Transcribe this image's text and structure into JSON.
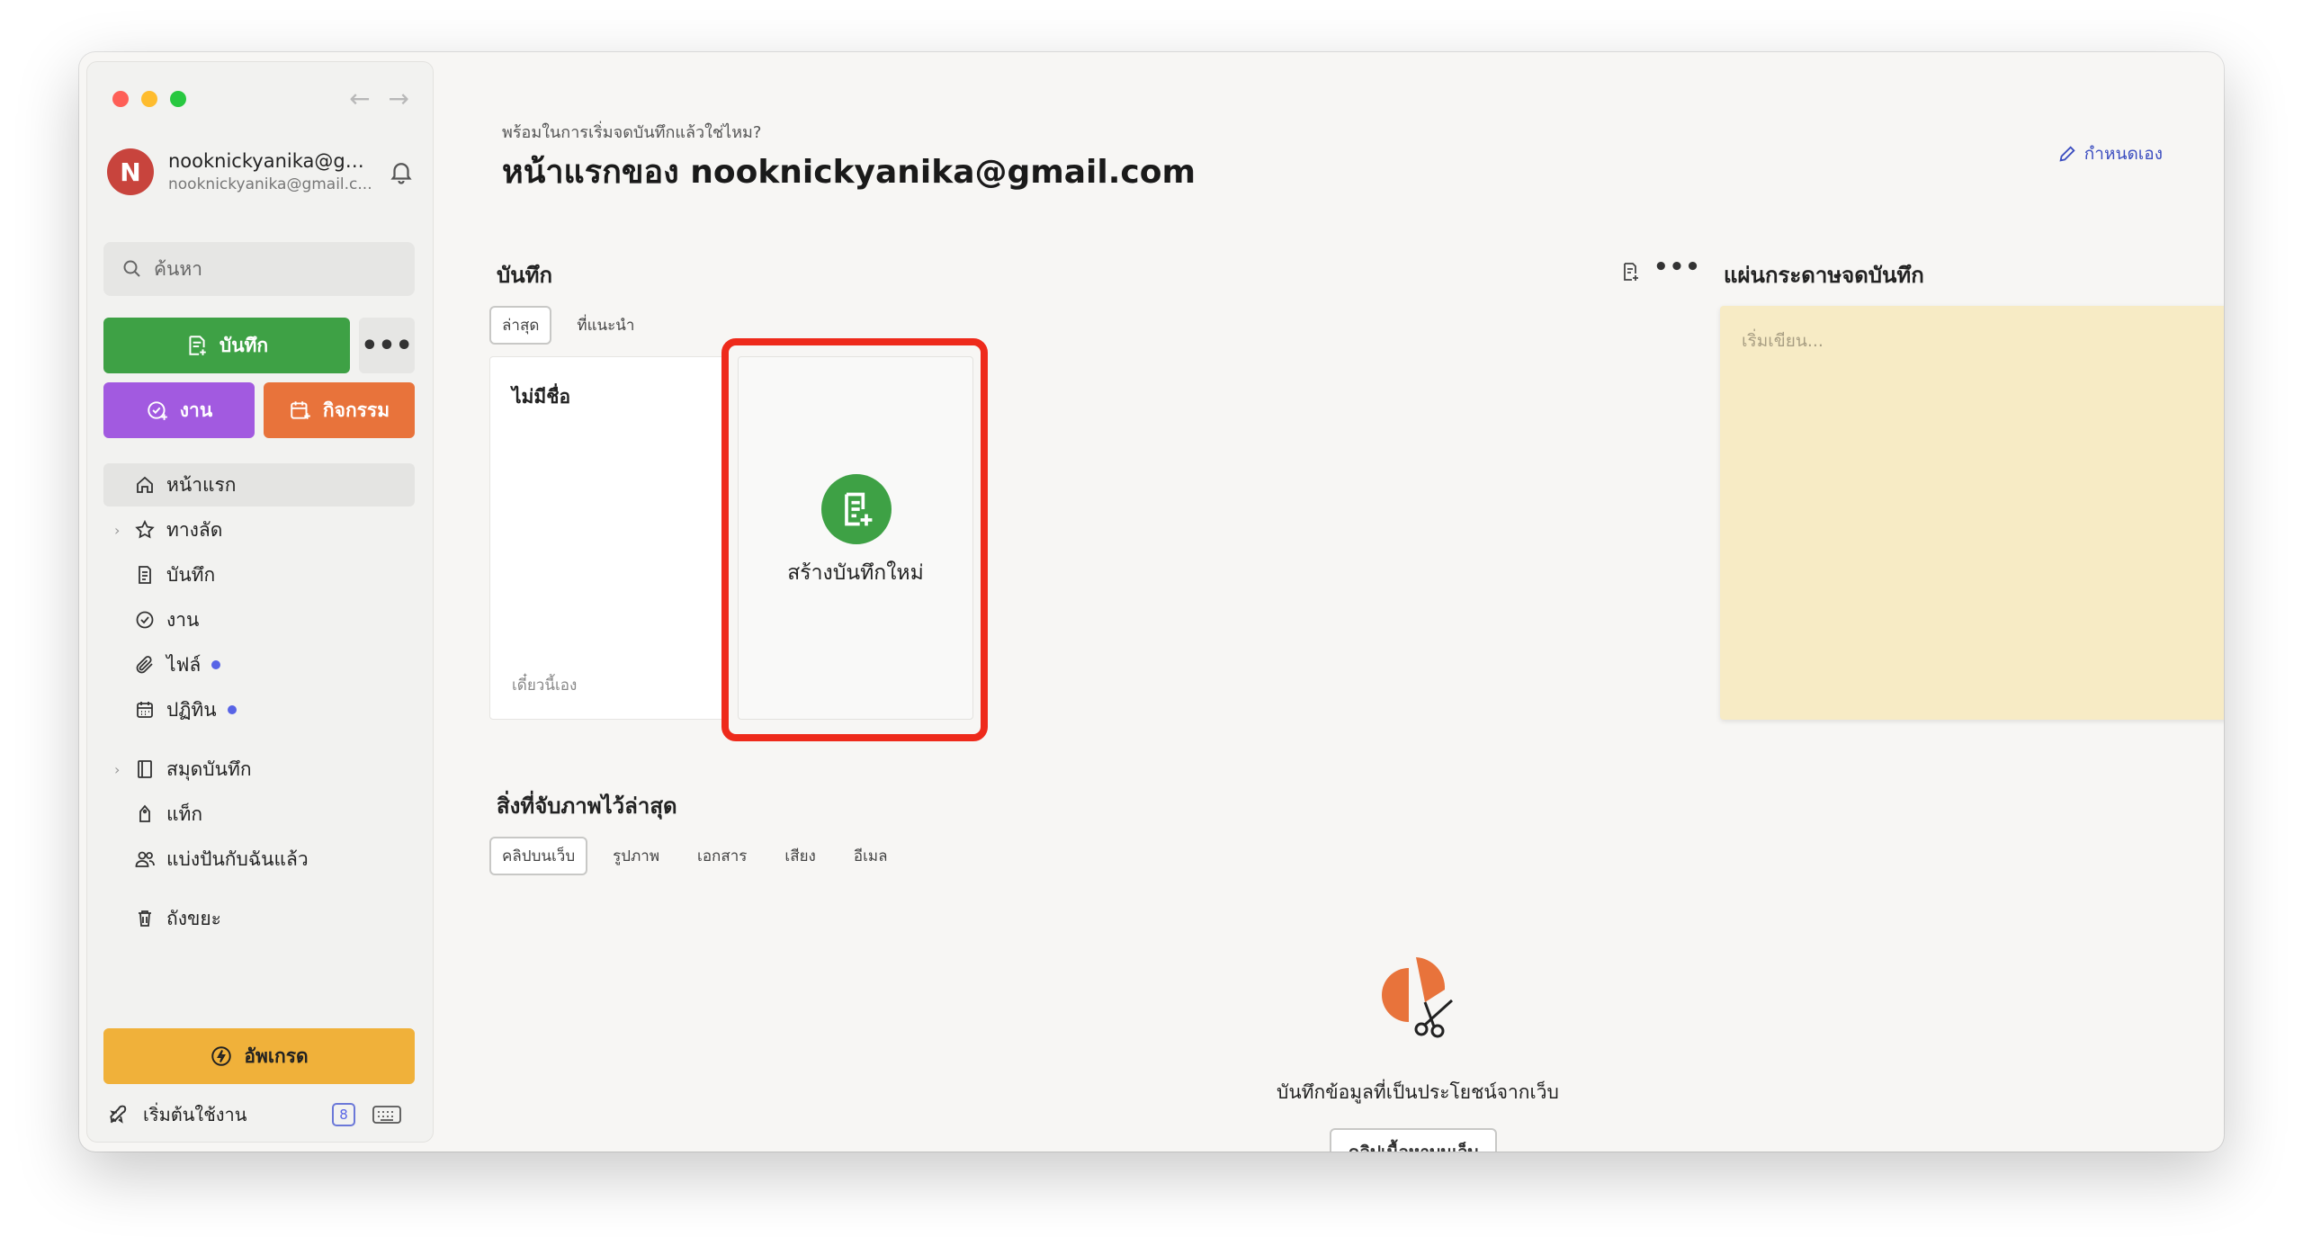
{
  "account": {
    "initial": "N",
    "name": "nooknickyanika@gm...",
    "email": "nooknickyanika@gmail.c..."
  },
  "search": {
    "placeholder": "ค้นหา"
  },
  "sidebar": {
    "new_note_label": "บันทึก",
    "more_label": "•••",
    "task_label": "งาน",
    "event_label": "กิจกรรม",
    "nav": {
      "home": "หน้าแรก",
      "shortcuts": "ทางลัด",
      "notes": "บันทึก",
      "tasks": "งาน",
      "files": "ไฟล์",
      "calendar": "ปฏิทิน",
      "notebooks": "สมุดบันทึก",
      "tags": "แท็ก",
      "shared": "แบ่งปันกับฉันแล้ว",
      "trash": "ถังขยะ"
    },
    "upgrade_label": "อัพเกรด",
    "get_started_label": "เริ่มต้นใช้งาน",
    "get_started_count": "8"
  },
  "header": {
    "subtitle": "พร้อมในการเริ่มจดบันทึกแล้วใช่ไหม?",
    "title": "หน้าแรกของ nooknickyanika@gmail.com",
    "customize_label": "กำหนดเอง"
  },
  "notes_widget": {
    "title": "บันทึก",
    "more": "•••",
    "tabs": [
      "ล่าสุด",
      "ที่แนะนำ"
    ],
    "card": {
      "title": "ไม่มีชื่อ",
      "date": "เดี๋ยวนี้เอง"
    },
    "new_note_label": "สร้างบันทึกใหม่"
  },
  "scratchpad": {
    "title": "แผ่นกระดาษจดบันทึก",
    "more": "•••",
    "placeholder": "เริ่มเขียน..."
  },
  "captures": {
    "title": "สิ่งที่จับภาพไว้ล่าสุด",
    "more": "•••",
    "tabs": [
      "คลิปบนเว็บ",
      "รูปภาพ",
      "เอกสาร",
      "เสียง",
      "อีเมล"
    ],
    "empty_text": "บันทึกข้อมูลที่เป็นประโยชน์จากเว็บ",
    "clip_button": "คลิปเนื้อหาบนเว็บ"
  },
  "colors": {
    "green": "#3ea145",
    "purple": "#a25ae0",
    "orange": "#e8733b",
    "yellow": "#f0b13a",
    "highlight": "#ee2a1b",
    "accent_blue": "#3c4ec0",
    "sticky": "#f7ebc5"
  }
}
